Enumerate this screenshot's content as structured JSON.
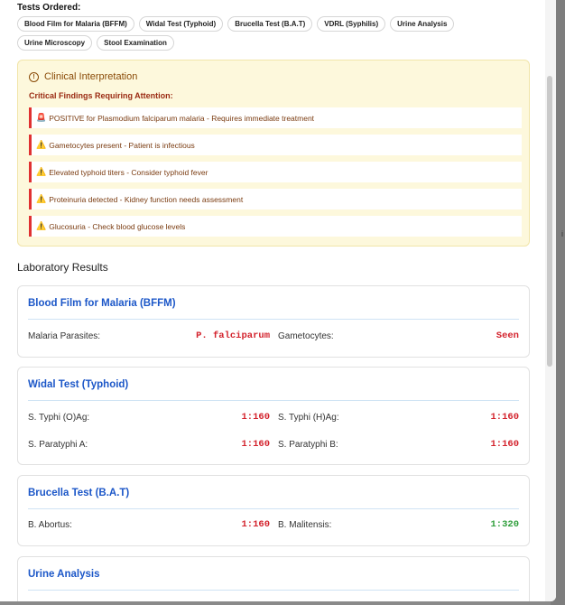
{
  "tests_ordered": {
    "title": "Tests Ordered:",
    "chips": [
      "Blood Film for Malaria (BFFM)",
      "Widal Test (Typhoid)",
      "Brucella Test (B.A.T)",
      "VDRL (Syphilis)",
      "Urine Analysis",
      "Urine Microscopy",
      "Stool Examination"
    ]
  },
  "interpretation": {
    "title": "Clinical Interpretation",
    "subtitle": "Critical Findings Requiring Attention:",
    "findings": [
      {
        "icon": "🚨",
        "text": "POSITIVE for Plasmodium falciparum malaria - Requires immediate treatment"
      },
      {
        "icon": "⚠️",
        "text": "Gametocytes present - Patient is infectious"
      },
      {
        "icon": "⚠️",
        "text": "Elevated typhoid titers - Consider typhoid fever"
      },
      {
        "icon": "⚠️",
        "text": "Proteinuria detected - Kidney function needs assessment"
      },
      {
        "icon": "⚠️",
        "text": "Glucosuria - Check blood glucose levels"
      }
    ]
  },
  "results": {
    "title": "Laboratory Results",
    "bffm": {
      "title": "Blood Film for Malaria (BFFM)",
      "rows": [
        {
          "label1": "Malaria Parasites:",
          "value1": "P. falciparum",
          "label2": "Gametocytes:",
          "value2": "Seen"
        }
      ]
    },
    "widal": {
      "title": "Widal Test (Typhoid)",
      "rows": [
        {
          "label1": "S. Typhi (O)Ag:",
          "value1": "1:160",
          "label2": "S. Typhi (H)Ag:",
          "value2": "1:160"
        },
        {
          "label1": "S. Paratyphi A:",
          "value1": "1:160",
          "label2": "S. Paratyphi B:",
          "value2": "1:160"
        }
      ]
    },
    "brucella": {
      "title": "Brucella Test (B.A.T)",
      "rows": [
        {
          "label1": "B. Abortus:",
          "value1": "1:160",
          "label2": "B. Malitensis:",
          "value2": "1:320"
        }
      ]
    },
    "urine": {
      "title": "Urine Analysis"
    }
  },
  "colors": {
    "abnormal": "#d3222c",
    "normal": "#2e9e3a",
    "accent": "#1c57c8"
  }
}
